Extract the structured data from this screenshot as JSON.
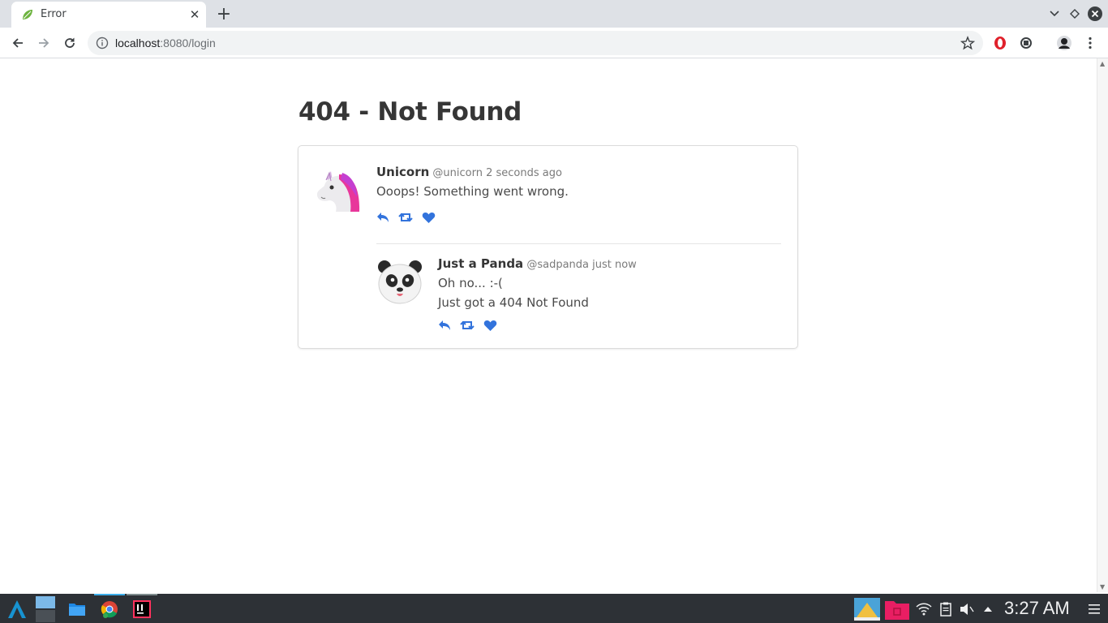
{
  "browser": {
    "tab_title": "Error",
    "url_host": "localhost",
    "url_rest": ":8080/login"
  },
  "page": {
    "title": "404 - Not Found"
  },
  "tweets": [
    {
      "name": "Unicorn",
      "handle": "@unicorn",
      "time": "2 seconds ago",
      "lines": [
        "Ooops! Something went wrong."
      ],
      "avatar": "unicorn-emoji"
    },
    {
      "name": "Just a Panda",
      "handle": "@sadpanda",
      "time": "just now",
      "lines": [
        "Oh no... :-(",
        "Just got a 404 Not Found"
      ],
      "avatar": "panda-emoji"
    }
  ],
  "taskbar": {
    "clock": "3:27 AM"
  },
  "colors": {
    "action_blue": "#3273dc",
    "taskbar_bg": "#2d3136"
  }
}
